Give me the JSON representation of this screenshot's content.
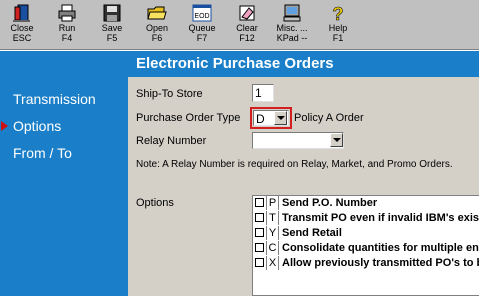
{
  "toolbar": {
    "buttons": [
      {
        "line1": "Close",
        "line2": "ESC",
        "icon": "exit-door-icon"
      },
      {
        "line1": "Run",
        "line2": "F4",
        "icon": "printer-icon"
      },
      {
        "line1": "Save",
        "line2": "F5",
        "icon": "floppy-disk-icon"
      },
      {
        "line1": "Open",
        "line2": "F6",
        "icon": "open-folder-icon"
      },
      {
        "line1": "Queue",
        "line2": "F7",
        "icon": "queue-eod-icon",
        "badge": "EOD"
      },
      {
        "line1": "Clear",
        "line2": "F12",
        "icon": "eraser-icon"
      },
      {
        "line1": "Misc. ...",
        "line2": "KPad --",
        "icon": "computer-icon"
      },
      {
        "line1": "Help",
        "line2": "F1",
        "icon": "help-icon"
      }
    ]
  },
  "sidebar": {
    "items": [
      {
        "label": "Transmission",
        "selected": false
      },
      {
        "label": "Options",
        "selected": true
      },
      {
        "label": "From / To",
        "selected": false
      }
    ]
  },
  "header": {
    "title": "Electronic Purchase Orders"
  },
  "form": {
    "ship_to_label": "Ship-To Store",
    "ship_to_value": "1",
    "po_type_label": "Purchase Order Type",
    "po_type_value": "D",
    "po_type_desc": "Policy A Order",
    "relay_label": "Relay Number",
    "relay_value": "",
    "note": "Note:  A Relay Number is required on Relay, Market, and Promo Orders.",
    "options_label": "Options"
  },
  "options": [
    {
      "code": "P",
      "desc": "Send P.O. Number",
      "checked": false
    },
    {
      "code": "T",
      "desc": "Transmit PO even if invalid IBM's exist",
      "checked": false
    },
    {
      "code": "Y",
      "desc": "Send Retail",
      "checked": false
    },
    {
      "code": "C",
      "desc": "Consolidate quantities for multiple entries",
      "checked": false
    },
    {
      "code": "X",
      "desc": "Allow previously transmitted PO's to be resent",
      "checked": false
    }
  ],
  "colors": {
    "sidebar_bg": "#1a7fc8",
    "form_bg": "#d4d0c8",
    "toolbar_bg": "#c0c0c0",
    "highlight": "#d22020"
  }
}
